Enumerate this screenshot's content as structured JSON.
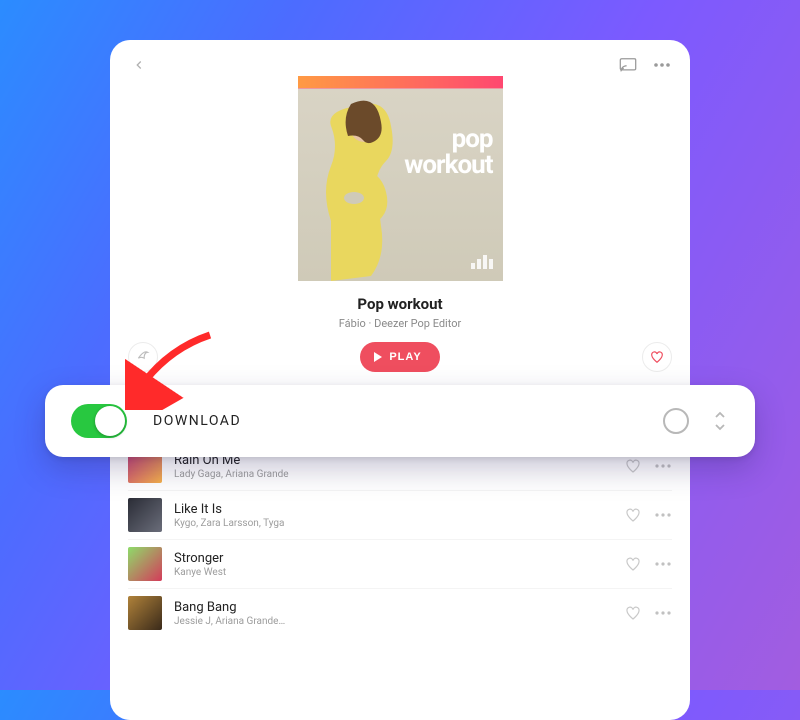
{
  "cover": {
    "line1": "pop",
    "line2": "workout"
  },
  "playlist": {
    "title": "Pop workout",
    "subtitle": "Fábio · Deezer Pop Editor",
    "play_label": "PLAY"
  },
  "download": {
    "label": "DOWNLOAD",
    "enabled": true
  },
  "tracks": [
    {
      "name": "Rain On Me",
      "artist": "Lady Gaga, Ariana Grande"
    },
    {
      "name": "Like It Is",
      "artist": "Kygo, Zara Larsson, Tyga"
    },
    {
      "name": "Stronger",
      "artist": "Kanye West"
    },
    {
      "name": "Bang Bang",
      "artist": "Jessie J, Ariana Grande…"
    }
  ]
}
